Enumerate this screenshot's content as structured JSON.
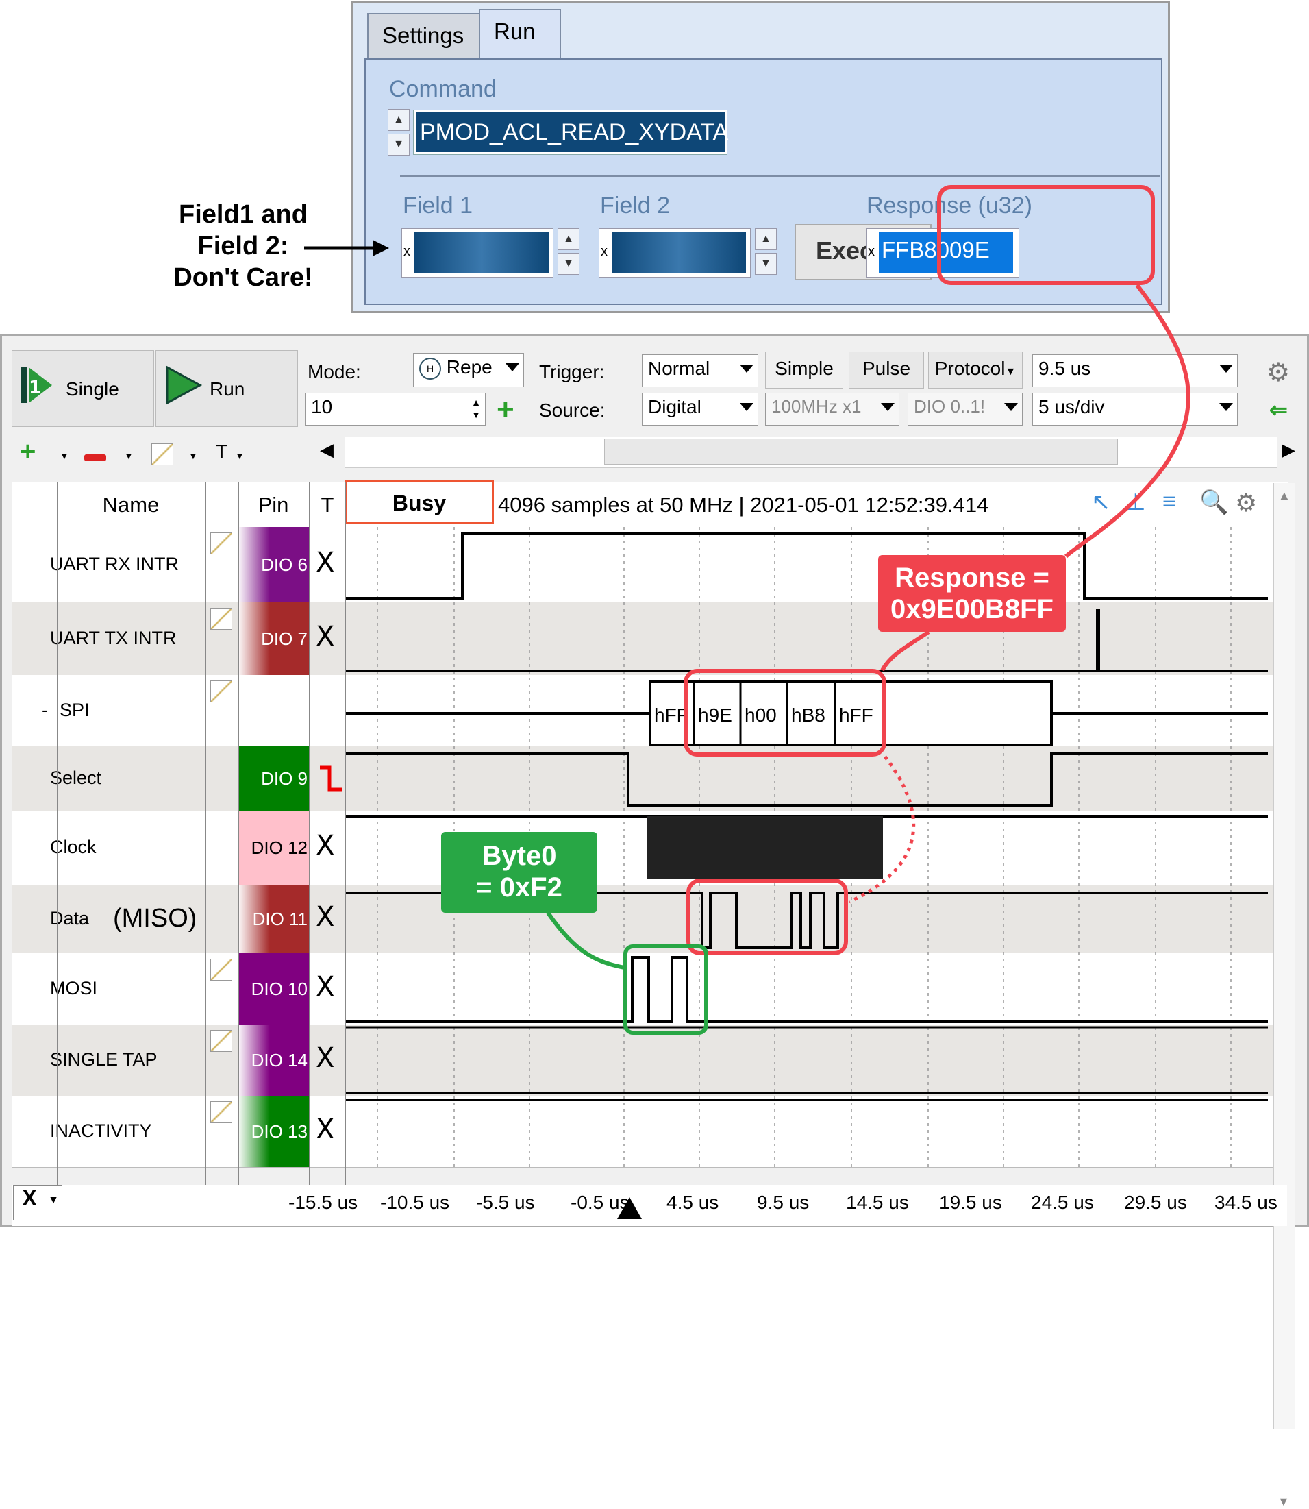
{
  "dialog": {
    "tabs": [
      {
        "label": "Settings"
      },
      {
        "label": "Run"
      }
    ],
    "command_label": "Command",
    "command_value": "PMOD_ACL_READ_XYDATA",
    "field1_label": "Field 1",
    "field2_label": "Field 2",
    "field_prefix": "x",
    "execute_label": "Execute",
    "response_label": "Response (u32)",
    "response_prefix": "x",
    "response_value": "FFB8009E"
  },
  "annotations": {
    "fields_note": [
      "Field1 and",
      "Field 2:",
      "Don't Care!"
    ],
    "response_note": [
      "Response =",
      "0x9E00B8FF"
    ],
    "byte0_note": [
      "Byte0",
      "= 0xF2"
    ]
  },
  "toolbar": {
    "single_label": "Single",
    "run_label": "Run",
    "mode_label": "Mode:",
    "mode_value": "Repe",
    "count_value": "10",
    "trigger_label": "Trigger:",
    "trigger_value": "Normal",
    "simple_label": "Simple",
    "pulse_label": "Pulse",
    "protocol_label": "Protocol",
    "position_value": "9.5 us",
    "source_label": "Source:",
    "source_value": "Digital",
    "rate_value": "100MHz x1",
    "dio_value": "DIO 0..1!",
    "base_value": "5 us/div",
    "t_label": "T"
  },
  "header": {
    "name_col": "Name",
    "pin_col": "Pin",
    "t_col": "T",
    "status": "Busy",
    "info": "4096 samples at 50 MHz | 2021-05-01 12:52:39.414"
  },
  "rows": [
    {
      "name": "UART RX INTR",
      "pin": "DIO  6",
      "trig": "X",
      "color": "#7b0f85"
    },
    {
      "name": "UART TX INTR",
      "pin": "DIO  7",
      "trig": "X",
      "color": "#a52a2a"
    },
    {
      "name": "SPI",
      "pin": "",
      "trig": "",
      "color": "",
      "prefix": "-"
    },
    {
      "name": "Select",
      "pin": "DIO  9",
      "trig": "falling-edge",
      "color": "#008000"
    },
    {
      "name": "Clock",
      "pin": "DIO 12",
      "trig": "X",
      "color": "#ffc0cb"
    },
    {
      "name": "Data",
      "pin": "DIO 11",
      "trig": "X",
      "color": "#a52a2a",
      "suffix": "(MISO)"
    },
    {
      "name": "MOSI",
      "pin": "DIO 10",
      "trig": "X",
      "color": "#800080"
    },
    {
      "name": "SINGLE TAP",
      "pin": "DIO 14",
      "trig": "X",
      "color": "#800080"
    },
    {
      "name": "INACTIVITY",
      "pin": "DIO 13",
      "trig": "X",
      "color": "#008000"
    }
  ],
  "spi_bytes": [
    "hFF",
    "h9E",
    "h00",
    "hB8",
    "hFF"
  ],
  "time_axis": [
    "-15.5 us",
    "-10.5 us",
    "-5.5 us",
    "-0.5 us",
    "4.5 us",
    "9.5 us",
    "14.5 us",
    "19.5 us",
    "24.5 us",
    "29.5 us",
    "34.5 us"
  ],
  "cursor_label": "X"
}
